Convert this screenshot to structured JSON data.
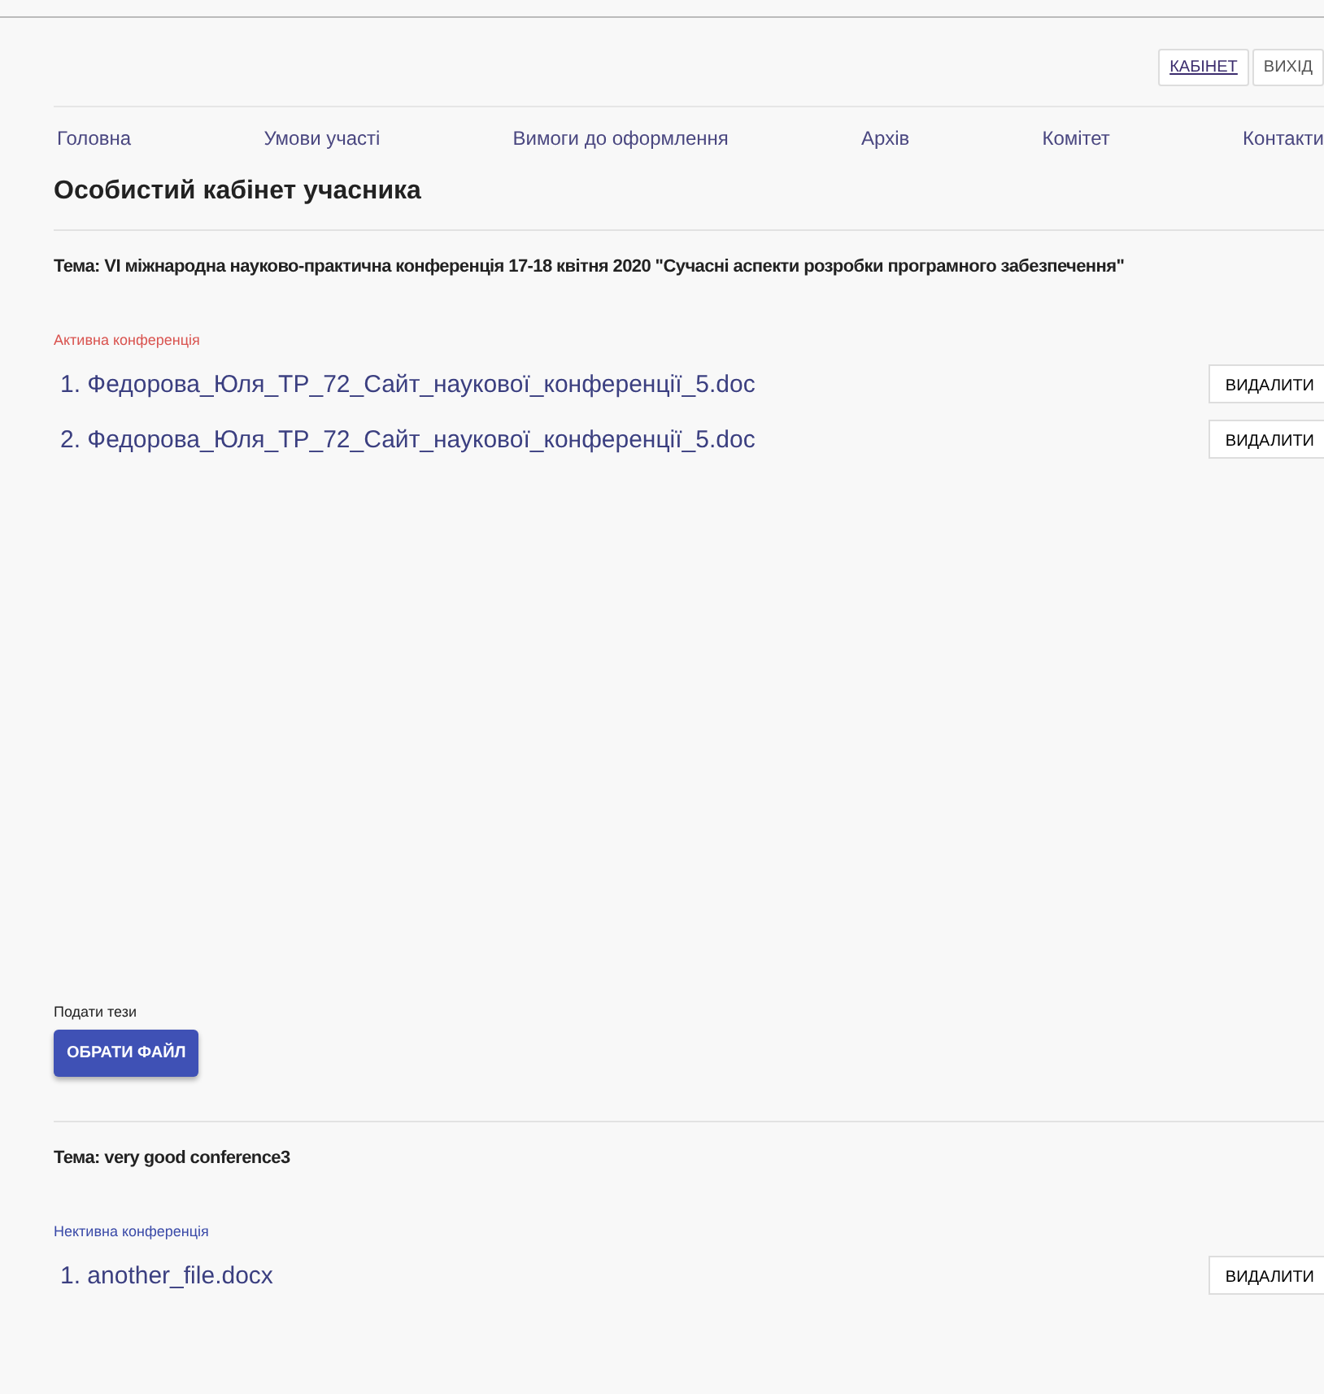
{
  "header": {
    "buttons": [
      {
        "label": "КАБІНЕТ",
        "selected": true
      },
      {
        "label": "ВИХІД",
        "selected": false
      }
    ]
  },
  "nav": [
    "Головна",
    "Умови участі",
    "Вимоги до оформлення",
    "Архів",
    "Комітет",
    "Контакти"
  ],
  "page_title": "Особистий кабінет учасника",
  "conferences": [
    {
      "theme": "Тема: VI міжнародна науково-практична конференція 17-18 квітня 2020 \"Сучасні аспекти розробки програмного забезпечення\"",
      "active": true,
      "status": "Активна конференція",
      "files": [
        {
          "name": "1. Федорова_Юля_ТР_72_Сайт_наукової_конференції_5.doc",
          "action": "ВИДАЛИТИ"
        },
        {
          "name": "2. Федорова_Юля_ТР_72_Сайт_наукової_конференції_5.doc",
          "action": "ВИДАЛИТИ"
        }
      ],
      "upload": {
        "label": "Подати тези",
        "button": "ОБРАТИ ФАЙЛ"
      }
    },
    {
      "theme": "Тема: very good conference3",
      "active": false,
      "status": "Нективна конференція",
      "files": [
        {
          "name": "1. another_file.docx",
          "action": "ВИДАЛИТИ"
        }
      ]
    }
  ]
}
